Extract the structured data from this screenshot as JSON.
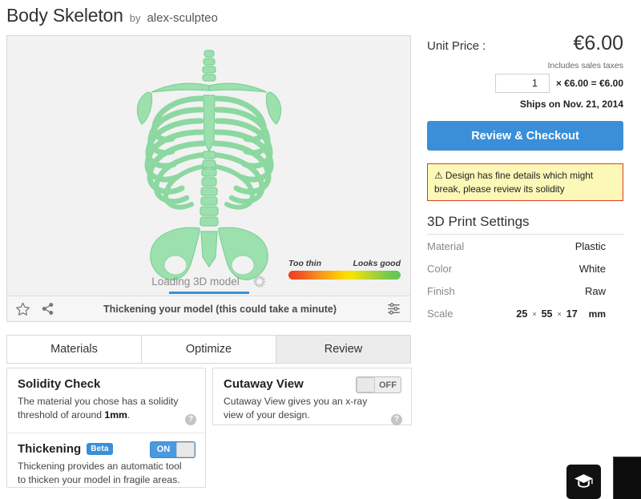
{
  "header": {
    "model_title": "Body Skeleton",
    "by_word": "by",
    "author": "alex-sculpteo"
  },
  "viewer": {
    "loading_text": "Loading 3D model",
    "spinner_icon": "spinner-icon",
    "status_text": "Thickening your model (this could take a minute)",
    "favorite_icon": "star-icon",
    "share_icon": "share-icon",
    "settings_icon": "sliders-icon",
    "thickness_legend": {
      "low_label": "Too thin",
      "high_label": "Looks good",
      "gradient_start": "#ef3b24",
      "gradient_mid": "#ffd400",
      "gradient_end": "#5ec65a"
    },
    "model_color": "#9ce0ae",
    "background_color": "#f2f2f2"
  },
  "tabs": [
    {
      "label": "Materials",
      "active": false
    },
    {
      "label": "Optimize",
      "active": false
    },
    {
      "label": "Review",
      "active": true
    }
  ],
  "cards": {
    "solidity": {
      "title": "Solidity Check",
      "description_prefix": "The material you chose has a solidity threshold of around ",
      "description_value": "1mm",
      "description_suffix": ".",
      "help_icon_label": "?"
    },
    "thickening": {
      "title": "Thickening",
      "badge": "Beta",
      "toggle_state": "ON",
      "description": "Thickening provides an automatic tool to thicken your model in fragile areas."
    },
    "cutaway": {
      "title": "Cutaway View",
      "toggle_state": "OFF",
      "description": "Cutaway View gives you an x-ray view of your design.",
      "help_icon_label": "?"
    }
  },
  "pricing": {
    "unit_price_label": "Unit Price :",
    "unit_price_value": "€6.00",
    "taxes_note": "Includes sales taxes",
    "quantity_value": "1",
    "quantity_placeholder": "1",
    "calculation": "× €6.00 = €6.00",
    "ships_on": "Ships on Nov. 21, 2014",
    "checkout_label": "Review & Checkout",
    "accent_color": "#3a8fd8"
  },
  "warning": {
    "icon": "warning-triangle-icon",
    "text": "Design has fine details which might break, please review its solidity",
    "background": "#fcf8b8",
    "border_color": "#e03b28"
  },
  "print_settings": {
    "title": "3D Print Settings",
    "rows": [
      {
        "key": "Material",
        "value": "Plastic"
      },
      {
        "key": "Color",
        "value": "White"
      },
      {
        "key": "Finish",
        "value": "Raw"
      }
    ],
    "scale": {
      "key": "Scale",
      "x": "25",
      "y": "55",
      "z": "17",
      "sep": "×",
      "unit": "mm"
    }
  },
  "widgets": {
    "education_icon": "graduation-cap-icon"
  }
}
